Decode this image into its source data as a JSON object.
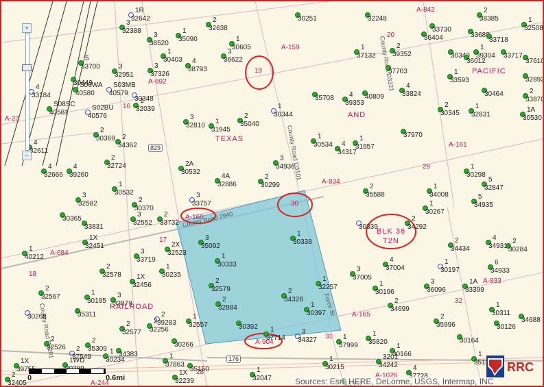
{
  "map": {
    "attribution": "Sources: Esri, HERE, DeLorme, USGS, Intermap, INC",
    "scale": {
      "zero": "0",
      "end": "0.6mi"
    },
    "zoom": {
      "plus": "+",
      "minus": "−"
    },
    "highlight_color": "#7ec8d8",
    "annotation_color": "#e02020",
    "well_color": "#2ea82e",
    "text_labels": [
      {
        "t": "TEXAS",
        "c": "pink"
      },
      {
        "t": "AND",
        "c": "pink"
      },
      {
        "t": "PACIFIC",
        "c": "pink"
      },
      {
        "t": "RAILROAD",
        "c": "pink"
      },
      {
        "t": "BLK 36",
        "c": "pink"
      },
      {
        "t": "T2N",
        "c": "pink"
      },
      {
        "t": "A-842",
        "c": "survey"
      },
      {
        "t": "A-159",
        "c": "survey"
      },
      {
        "t": "A-692",
        "c": "survey"
      },
      {
        "t": "A-161",
        "c": "survey"
      },
      {
        "t": "A-834",
        "c": "survey"
      },
      {
        "t": "A-160",
        "c": "survey"
      },
      {
        "t": "A-684",
        "c": "survey"
      },
      {
        "t": "A-833",
        "c": "survey"
      },
      {
        "t": "A-165",
        "c": "survey"
      },
      {
        "t": "A-904",
        "c": "survey"
      },
      {
        "t": "A-244",
        "c": "survey"
      },
      {
        "t": "A-1026",
        "c": "survey"
      },
      {
        "t": "A-23",
        "c": "survey"
      },
      {
        "t": "19",
        "c": "survey"
      },
      {
        "t": "30",
        "c": "survey"
      },
      {
        "t": "29",
        "c": "survey"
      },
      {
        "t": "16",
        "c": "survey"
      },
      {
        "t": "17",
        "c": "survey"
      },
      {
        "t": "18",
        "c": "survey"
      },
      {
        "t": "32",
        "c": "survey"
      },
      {
        "t": "28",
        "c": "survey"
      },
      {
        "t": "31",
        "c": "survey"
      },
      {
        "t": "20",
        "c": "survey"
      },
      {
        "t": "County Road D3101",
        "c": "road"
      },
      {
        "t": "County Road 2940",
        "c": "road"
      },
      {
        "t": "County Road D3201",
        "c": "road"
      },
      {
        "t": "County Road D3321",
        "c": "road"
      },
      {
        "t": "Force St",
        "c": "road"
      },
      {
        "t": "829",
        "c": "shield"
      },
      {
        "t": "176",
        "c": "shield"
      }
    ],
    "well_labels": [
      {
        "n": "1R",
        "id": "32642"
      },
      {
        "n": "",
        "id": "30251"
      },
      {
        "n": "",
        "id": "32248"
      },
      {
        "n": "2",
        "id": "38385"
      },
      {
        "n": "1",
        "id": "32508"
      },
      {
        "n": "3",
        "id": "32388"
      },
      {
        "n": "1",
        "id": "35090"
      },
      {
        "n": "2",
        "id": "32638"
      },
      {
        "n": "1",
        "id": "30605"
      },
      {
        "n": "",
        "id": "33730"
      },
      {
        "n": "",
        "id": "36404"
      },
      {
        "n": "",
        "id": "33688"
      },
      {
        "n": "",
        "id": "33718"
      },
      {
        "n": "3",
        "id": "38520"
      },
      {
        "n": "1",
        "id": "30403"
      },
      {
        "n": "4",
        "id": "38793"
      },
      {
        "n": "3",
        "id": "36622"
      },
      {
        "n": "1",
        "id": "37132"
      },
      {
        "n": "2",
        "id": "39352"
      },
      {
        "n": "",
        "id": "30340"
      },
      {
        "n": "1",
        "id": "39304"
      },
      {
        "n": "",
        "id": "33717"
      },
      {
        "n": "",
        "id": "37610"
      },
      {
        "n": "5",
        "id": "33700"
      },
      {
        "n": "3",
        "id": "32951"
      },
      {
        "n": "3",
        "id": "37326"
      },
      {
        "n": "",
        "id": "36012"
      },
      {
        "n": "",
        "id": "32893"
      },
      {
        "n": "",
        "id": "30449"
      },
      {
        "n": "S06WA",
        "id": "40580"
      },
      {
        "n": "S03MB",
        "id": "40579"
      },
      {
        "n": "",
        "id": "30348"
      },
      {
        "n": "",
        "id": "37703"
      },
      {
        "n": "4",
        "id": "33824"
      },
      {
        "n": "1",
        "id": "33593"
      },
      {
        "n": "",
        "id": "30464"
      },
      {
        "n": "4",
        "id": "33184"
      },
      {
        "n": "S08SC",
        "id": "40581"
      },
      {
        "n": "S02BU",
        "id": "40576"
      },
      {
        "n": "1",
        "id": "32039"
      },
      {
        "n": "",
        "id": "35708"
      },
      {
        "n": "4",
        "id": "39353"
      },
      {
        "n": "",
        "id": "40809"
      },
      {
        "n": "2",
        "id": "33870"
      },
      {
        "n": "2",
        "id": "30345"
      },
      {
        "n": "1",
        "id": "32831"
      },
      {
        "n": "1A",
        "id": "30530"
      },
      {
        "n": "3",
        "id": "32810"
      },
      {
        "n": "1",
        "id": "31945"
      },
      {
        "n": "2",
        "id": "35040"
      },
      {
        "n": "1",
        "id": "30344"
      },
      {
        "n": "",
        "id": "37970"
      },
      {
        "n": "2",
        "id": "30369"
      },
      {
        "n": "2",
        "id": "34362"
      },
      {
        "n": "1",
        "id": "30534"
      },
      {
        "n": "4",
        "id": "34317"
      },
      {
        "n": "1",
        "id": "31957"
      },
      {
        "n": "4",
        "id": "32611"
      },
      {
        "n": "2",
        "id": "32724"
      },
      {
        "n": "2A",
        "id": "30532"
      },
      {
        "n": "3",
        "id": "34936"
      },
      {
        "n": "1",
        "id": "30298"
      },
      {
        "n": "4",
        "id": "32666"
      },
      {
        "n": "4",
        "id": "39260"
      },
      {
        "n": "4A",
        "id": "32886"
      },
      {
        "n": "2",
        "id": "30299"
      },
      {
        "n": "5",
        "id": "32847"
      },
      {
        "n": "1",
        "id": "30532"
      },
      {
        "n": "2",
        "id": "35588"
      },
      {
        "n": "1",
        "id": "34008"
      },
      {
        "n": "3",
        "id": "32582"
      },
      {
        "n": "2",
        "id": "30370"
      },
      {
        "n": "3",
        "id": "33757"
      },
      {
        "n": "5",
        "id": "34935"
      },
      {
        "n": "",
        "id": "30365"
      },
      {
        "n": "3",
        "id": "32552"
      },
      {
        "n": "2",
        "id": "33732"
      },
      {
        "n": "1",
        "id": "30267"
      },
      {
        "n": "",
        "id": "33831"
      },
      {
        "n": "",
        "id": "30339"
      },
      {
        "n": "2",
        "id": "34292"
      },
      {
        "n": "1X",
        "id": "32451"
      },
      {
        "n": "3",
        "id": "35092"
      },
      {
        "n": "1",
        "id": "30338"
      },
      {
        "n": "2",
        "id": "34434"
      },
      {
        "n": "4",
        "id": "34931"
      },
      {
        "n": "1",
        "id": "40212"
      },
      {
        "n": "3",
        "id": "33719"
      },
      {
        "n": "2X",
        "id": "32523"
      },
      {
        "n": "1",
        "id": "30333"
      },
      {
        "n": "2",
        "id": "30284"
      },
      {
        "n": "4",
        "id": "37004"
      },
      {
        "n": "2",
        "id": "32578"
      },
      {
        "n": "1X",
        "id": "32456"
      },
      {
        "n": "1",
        "id": "30235"
      },
      {
        "n": "3",
        "id": "37005"
      },
      {
        "n": "1",
        "id": "30197"
      },
      {
        "n": "6",
        "id": "34933"
      },
      {
        "n": "2",
        "id": "32579"
      },
      {
        "n": "1",
        "id": "32257"
      },
      {
        "n": "2",
        "id": "32567"
      },
      {
        "n": "1",
        "id": "30195"
      },
      {
        "n": "3",
        "id": "33879"
      },
      {
        "n": "2",
        "id": "34328"
      },
      {
        "n": "1",
        "id": "30196"
      },
      {
        "n": "3",
        "id": "36096"
      },
      {
        "n": "1A",
        "id": "33399"
      },
      {
        "n": "",
        "id": "35311"
      },
      {
        "n": "2",
        "id": "32884"
      },
      {
        "n": "1",
        "id": "30397"
      },
      {
        "n": "2",
        "id": "34699"
      },
      {
        "n": "1",
        "id": "30311"
      },
      {
        "n": "",
        "id": "30268"
      },
      {
        "n": "2",
        "id": "39283"
      },
      {
        "n": "2",
        "id": "32256"
      },
      {
        "n": "1",
        "id": "32557"
      },
      {
        "n": "",
        "id": "30392"
      },
      {
        "n": "2",
        "id": "35996"
      },
      {
        "n": "",
        "id": "30126"
      },
      {
        "n": "",
        "id": "34688"
      },
      {
        "n": "2",
        "id": "32577"
      },
      {
        "n": "1",
        "id": "37714"
      },
      {
        "n": "3",
        "id": "34327"
      },
      {
        "n": "1",
        "id": "37999"
      },
      {
        "n": "1",
        "id": "35820"
      },
      {
        "n": "",
        "id": "30164"
      },
      {
        "n": "2",
        "id": "32526"
      },
      {
        "n": "2",
        "id": "35309"
      },
      {
        "n": "2",
        "id": "37549"
      },
      {
        "n": "1",
        "id": "30234"
      },
      {
        "n": "",
        "id": "30266"
      },
      {
        "n": "",
        "id": "34383"
      },
      {
        "n": "1",
        "id": "30166"
      },
      {
        "n": "1",
        "id": "37863"
      },
      {
        "n": "1",
        "id": "30215"
      },
      {
        "n": "",
        "id": "35150"
      },
      {
        "n": "1X",
        "id": "39755"
      },
      {
        "n": "1WD",
        "id": "30289"
      },
      {
        "n": "1",
        "id": "32047"
      },
      {
        "n": "3201",
        "id": "34242"
      },
      {
        "n": "4",
        "id": "37728"
      },
      {
        "n": "1",
        "id": "35127"
      },
      {
        "n": "2",
        "id": "32405"
      },
      {
        "n": "1X",
        "id": "32239"
      },
      {
        "n": "",
        "id": "34352"
      }
    ]
  }
}
